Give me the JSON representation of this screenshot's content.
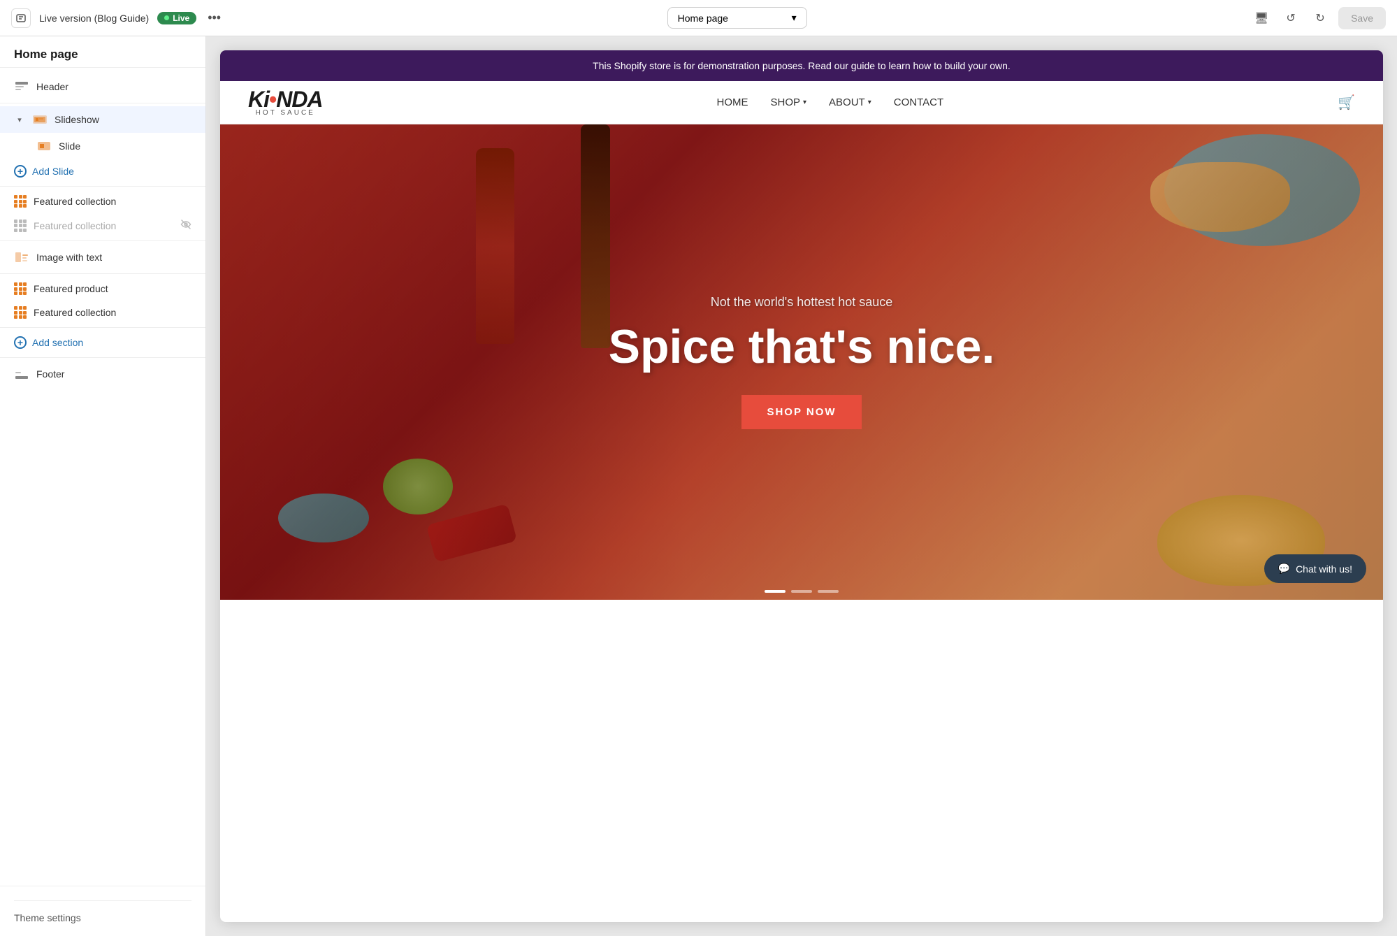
{
  "toolbar": {
    "back_label": "←",
    "title": "Live version (Blog Guide)",
    "live_badge": "Live",
    "more_label": "•••",
    "page_select": "Home page",
    "desktop_icon": "🖥",
    "undo_icon": "↺",
    "redo_icon": "↻",
    "save_label": "Save"
  },
  "sidebar": {
    "page_title": "Home page",
    "items": [
      {
        "id": "header",
        "label": "Header",
        "icon": "header",
        "has_children": false
      },
      {
        "id": "slideshow",
        "label": "Slideshow",
        "icon": "slideshow",
        "expanded": true,
        "has_children": true
      },
      {
        "id": "slide",
        "label": "Slide",
        "icon": "slide",
        "is_child": true
      },
      {
        "id": "add-slide",
        "label": "Add Slide",
        "is_add": true,
        "is_child": true
      },
      {
        "id": "featured-collection-1",
        "label": "Featured collection",
        "icon": "collection"
      },
      {
        "id": "featured-collection-2",
        "label": "Featured collection",
        "icon": "collection",
        "hidden": true
      },
      {
        "id": "image-with-text",
        "label": "Image with text",
        "icon": "image-text"
      },
      {
        "id": "featured-product",
        "label": "Featured product",
        "icon": "product"
      },
      {
        "id": "featured-collection-3",
        "label": "Featured collection",
        "icon": "collection"
      }
    ],
    "add_section_label": "Add section",
    "footer_label": "Theme settings"
  },
  "store": {
    "banner_text": "This Shopify store is for demonstration purposes. Read our guide to learn how to build your own.",
    "logo_text": "KiNDA",
    "logo_dot_color": "#e74c3c",
    "logo_sub": "HOT SAUCE",
    "nav_links": [
      {
        "label": "HOME"
      },
      {
        "label": "SHOP",
        "has_dropdown": true
      },
      {
        "label": "ABOUT",
        "has_dropdown": true
      },
      {
        "label": "CONTACT"
      }
    ],
    "hero": {
      "subtitle": "Not the world's hottest hot sauce",
      "title": "Spice that's nice.",
      "cta_label": "SHOP NOW"
    },
    "chat_label": "Chat with us!"
  }
}
